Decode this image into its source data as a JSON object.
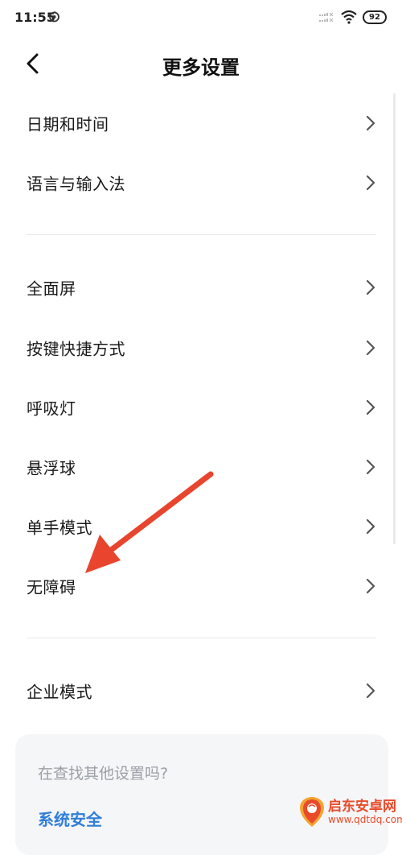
{
  "status_bar": {
    "time": "11:55",
    "battery": "92"
  },
  "header": {
    "title": "更多设置"
  },
  "sections": [
    {
      "items": [
        {
          "label": "日期和时间"
        },
        {
          "label": "语言与输入法"
        }
      ]
    },
    {
      "items": [
        {
          "label": "全面屏"
        },
        {
          "label": "按键快捷方式"
        },
        {
          "label": "呼吸灯"
        },
        {
          "label": "悬浮球"
        },
        {
          "label": "单手模式"
        },
        {
          "label": "无障碍"
        }
      ]
    },
    {
      "items": [
        {
          "label": "企业模式"
        }
      ]
    }
  ],
  "suggestions": {
    "title": "在查找其他设置吗?",
    "link": "系统安全"
  },
  "watermark": {
    "name": "启东安卓网",
    "url": "www.qdtdq.com"
  },
  "colors": {
    "link": "#2f7ed8",
    "annotation_arrow": "#e8442e"
  },
  "icons": {
    "back": "back-arrow-icon",
    "chevron": "chevron-right-icon"
  }
}
